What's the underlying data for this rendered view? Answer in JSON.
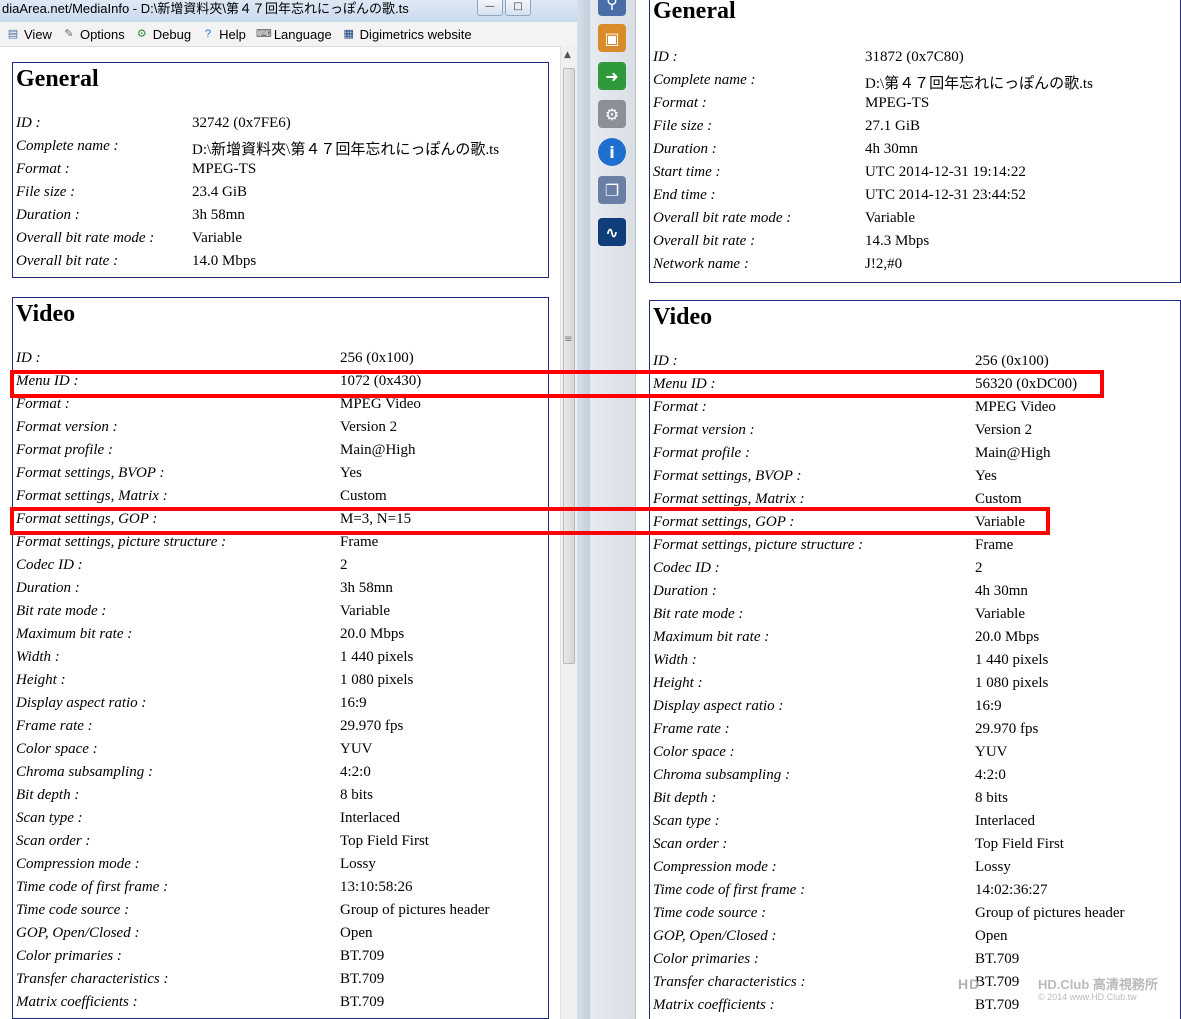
{
  "window": {
    "title": "diaArea.net/MediaInfo - D:\\新增資料夾\\第４７回年忘れにっぽんの歌.ts",
    "minimize_glyph": "—",
    "maximize_glyph": "□"
  },
  "menu": {
    "items": [
      {
        "label": "View",
        "icon": "view-icon"
      },
      {
        "label": "Options",
        "icon": "options-icon"
      },
      {
        "label": "Debug",
        "icon": "debug-icon"
      },
      {
        "label": "Help",
        "icon": "help-icon"
      },
      {
        "label": "Language",
        "icon": "language-icon"
      },
      {
        "label": "Digimetrics website",
        "icon": "digimetrics-icon"
      }
    ]
  },
  "scroll": {
    "grip": "≡",
    "up": "▲"
  },
  "left": {
    "general": {
      "title": "General",
      "rows": [
        {
          "label": "ID :",
          "value": "32742 (0x7FE6)"
        },
        {
          "label": "Complete name :",
          "value": "D:\\新增資料夾\\第４７回年忘れにっぽんの歌.ts"
        },
        {
          "label": "Format :",
          "value": "MPEG-TS"
        },
        {
          "label": "File size :",
          "value": "23.4 GiB"
        },
        {
          "label": "Duration :",
          "value": "3h 58mn"
        },
        {
          "label": "Overall bit rate mode :",
          "value": "Variable"
        },
        {
          "label": "Overall bit rate :",
          "value": "14.0 Mbps"
        }
      ]
    },
    "video": {
      "title": "Video",
      "rows": [
        {
          "label": "ID :",
          "value": "256 (0x100)"
        },
        {
          "label": "Menu ID :",
          "value": "1072 (0x430)"
        },
        {
          "label": "Format :",
          "value": "MPEG Video"
        },
        {
          "label": "Format version :",
          "value": "Version 2"
        },
        {
          "label": "Format profile :",
          "value": "Main@High"
        },
        {
          "label": "Format settings, BVOP :",
          "value": "Yes"
        },
        {
          "label": "Format settings, Matrix :",
          "value": "Custom"
        },
        {
          "label": "Format settings, GOP :",
          "value": "M=3, N=15"
        },
        {
          "label": "Format settings, picture structure :",
          "value": "Frame"
        },
        {
          "label": "Codec ID :",
          "value": "2"
        },
        {
          "label": "Duration :",
          "value": "3h 58mn"
        },
        {
          "label": "Bit rate mode :",
          "value": "Variable"
        },
        {
          "label": "Maximum bit rate :",
          "value": "20.0 Mbps"
        },
        {
          "label": "Width :",
          "value": "1 440 pixels"
        },
        {
          "label": "Height :",
          "value": "1 080 pixels"
        },
        {
          "label": "Display aspect ratio :",
          "value": "16:9"
        },
        {
          "label": "Frame rate :",
          "value": "29.970 fps"
        },
        {
          "label": "Color space :",
          "value": "YUV"
        },
        {
          "label": "Chroma subsampling :",
          "value": "4:2:0"
        },
        {
          "label": "Bit depth :",
          "value": "8 bits"
        },
        {
          "label": "Scan type :",
          "value": "Interlaced"
        },
        {
          "label": "Scan order :",
          "value": "Top Field First"
        },
        {
          "label": "Compression mode :",
          "value": "Lossy"
        },
        {
          "label": "Time code of first frame :",
          "value": "13:10:58:26"
        },
        {
          "label": "Time code source :",
          "value": "Group of pictures header"
        },
        {
          "label": "GOP, Open/Closed :",
          "value": "Open"
        },
        {
          "label": "Color primaries :",
          "value": "BT.709"
        },
        {
          "label": "Transfer characteristics :",
          "value": "BT.709"
        },
        {
          "label": "Matrix coefficients :",
          "value": "BT.709"
        }
      ]
    }
  },
  "right": {
    "general": {
      "title": "General",
      "rows": [
        {
          "label": "ID :",
          "value": "31872 (0x7C80)"
        },
        {
          "label": "Complete name :",
          "value": "D:\\第４７回年忘れにっぽんの歌.ts"
        },
        {
          "label": "Format :",
          "value": "MPEG-TS"
        },
        {
          "label": "File size :",
          "value": "27.1 GiB"
        },
        {
          "label": "Duration :",
          "value": "4h 30mn"
        },
        {
          "label": "Start time :",
          "value": "UTC 2014-12-31 19:14:22"
        },
        {
          "label": "End time :",
          "value": "UTC 2014-12-31 23:44:52"
        },
        {
          "label": "Overall bit rate mode :",
          "value": "Variable"
        },
        {
          "label": "Overall bit rate :",
          "value": "14.3 Mbps"
        },
        {
          "label": "Network name :",
          "value": "J!2,#0"
        }
      ]
    },
    "video": {
      "title": "Video",
      "rows": [
        {
          "label": "ID :",
          "value": "256 (0x100)"
        },
        {
          "label": "Menu ID :",
          "value": "56320 (0xDC00)"
        },
        {
          "label": "Format :",
          "value": "MPEG Video"
        },
        {
          "label": "Format version :",
          "value": "Version 2"
        },
        {
          "label": "Format profile :",
          "value": "Main@High"
        },
        {
          "label": "Format settings, BVOP :",
          "value": "Yes"
        },
        {
          "label": "Format settings, Matrix :",
          "value": "Custom"
        },
        {
          "label": "Format settings, GOP :",
          "value": "Variable"
        },
        {
          "label": "Format settings, picture structure :",
          "value": "Frame"
        },
        {
          "label": "Codec ID :",
          "value": "2"
        },
        {
          "label": "Duration :",
          "value": "4h 30mn"
        },
        {
          "label": "Bit rate mode :",
          "value": "Variable"
        },
        {
          "label": "Maximum bit rate :",
          "value": "20.0 Mbps"
        },
        {
          "label": "Width :",
          "value": "1 440 pixels"
        },
        {
          "label": "Height :",
          "value": "1 080 pixels"
        },
        {
          "label": "Display aspect ratio :",
          "value": "16:9"
        },
        {
          "label": "Frame rate :",
          "value": "29.970 fps"
        },
        {
          "label": "Color space :",
          "value": "YUV"
        },
        {
          "label": "Chroma subsampling :",
          "value": "4:2:0"
        },
        {
          "label": "Bit depth :",
          "value": "8 bits"
        },
        {
          "label": "Scan type :",
          "value": "Interlaced"
        },
        {
          "label": "Scan order :",
          "value": "Top Field First"
        },
        {
          "label": "Compression mode :",
          "value": "Lossy"
        },
        {
          "label": "Time code of first frame :",
          "value": "14:02:36:27"
        },
        {
          "label": "Time code source :",
          "value": "Group of pictures header"
        },
        {
          "label": "GOP, Open/Closed :",
          "value": "Open"
        },
        {
          "label": "Color primaries :",
          "value": "BT.709"
        },
        {
          "label": "Transfer characteristics :",
          "value": "BT.709"
        },
        {
          "label": "Matrix coefficients :",
          "value": "BT.709"
        }
      ]
    }
  },
  "toolbar": {
    "icons": [
      "search-icon",
      "package-icon",
      "import-info-icon",
      "tools-icon",
      "info-icon",
      "export-icon",
      "waveform-icon"
    ],
    "glyphs": [
      "⚲",
      "▣",
      "➜",
      "⚙",
      "i",
      "❐",
      "∿"
    ],
    "colors": [
      "#4a6da7",
      "#d98b2b",
      "#2f9a3c",
      "#8b8f96",
      "#1f6fd0",
      "#6a7fa6",
      "#0f3d7a"
    ]
  },
  "watermark": {
    "logo": "HD",
    "title": "HD.Club 高清視務所",
    "sub": "© 2014 www.HD.Club.tw"
  },
  "colors": {
    "section_border": "#1e2a80",
    "highlight": "#ff0000"
  }
}
